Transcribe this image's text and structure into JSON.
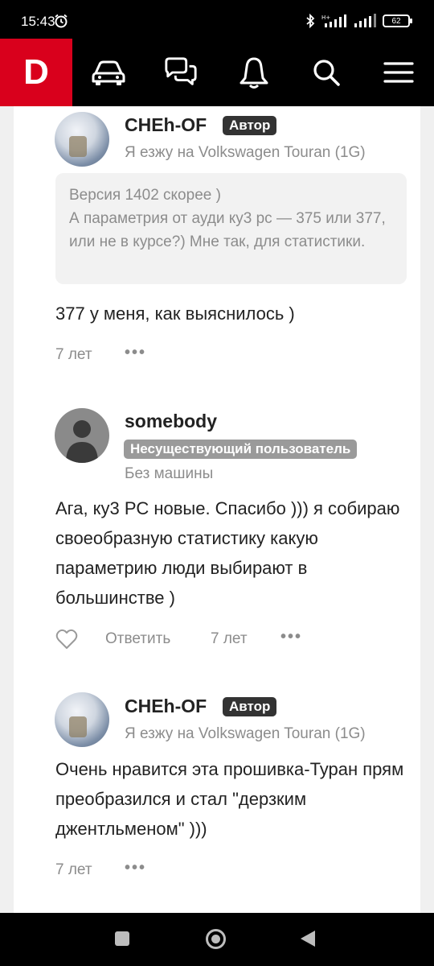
{
  "status_bar": {
    "time": "15:43",
    "battery": "62",
    "icons": [
      "alarm-icon",
      "bluetooth-icon",
      "signal-icon",
      "signal-icon",
      "battery-icon"
    ]
  },
  "app_bar": {
    "logo": "D",
    "icons": [
      "car-icon",
      "chat-icon",
      "bell-icon",
      "search-icon",
      "menu-icon"
    ]
  },
  "comments": [
    {
      "username": "CHEh-OF",
      "badge": "Автор",
      "car": "Я езжу на Volkswagen Touran (1G)",
      "quote": "Версия 1402 скорее )\nА параметрия от ауди ку3 рс — 375 или 377, или не в курсе?) Мне так, для статистики.",
      "text": "377 у меня, как выяснилось )",
      "time": "7 лет"
    },
    {
      "username": "somebody",
      "badge": "Несуществующий пользователь",
      "car": "Без машины",
      "text": "Ага, ку3 РС новые. Спасибо ))) я собираю своеобразную статистику какую параметрию люди выбирают в большинстве )",
      "reply": "Ответить",
      "time": "7 лет"
    },
    {
      "username": "CHEh-OF",
      "badge": "Автор",
      "car": "Я езжу на Volkswagen Touran (1G)",
      "text": "Очень нравится эта прошивка-Туран прям преобразился и стал \"дерзким джентльменом\" )))",
      "time": "7 лет"
    }
  ],
  "colors": {
    "brand": "#d9001c",
    "badge_author": "#333333",
    "badge_deleted": "#9a9a9a",
    "muted_text": "#8c8c8c"
  }
}
